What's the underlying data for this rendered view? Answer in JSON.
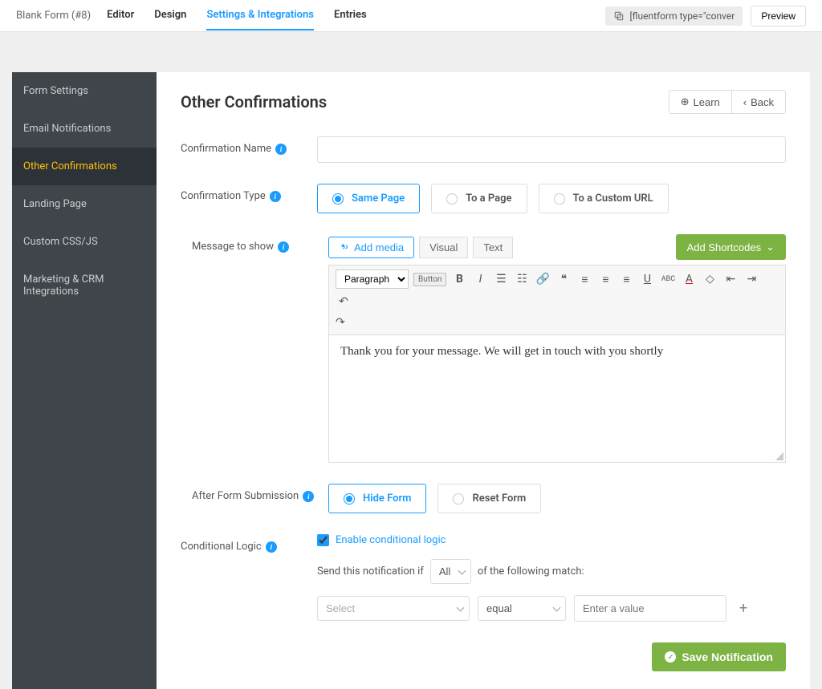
{
  "header": {
    "title": "Blank Form (#8)",
    "tabs": [
      "Editor",
      "Design",
      "Settings & Integrations",
      "Entries"
    ],
    "active_tab_index": 2,
    "shortcode": "[fluentform type=\"conver",
    "preview_label": "Preview"
  },
  "sidebar": {
    "items": [
      "Form Settings",
      "Email Notifications",
      "Other Confirmations",
      "Landing Page",
      "Custom CSS/JS",
      "Marketing & CRM Integrations"
    ],
    "active_index": 2
  },
  "page": {
    "title": "Other Confirmations",
    "learn_label": "Learn",
    "back_label": "Back"
  },
  "fields": {
    "confirmation_name": {
      "label": "Confirmation Name",
      "value": ""
    },
    "confirmation_type": {
      "label": "Confirmation Type",
      "options": [
        "Same Page",
        "To a Page",
        "To a Custom URL"
      ],
      "selected_index": 0
    },
    "message": {
      "label": "Message to show",
      "add_media_label": "Add media",
      "visual_label": "Visual",
      "text_label": "Text",
      "shortcodes_label": "Add Shortcodes",
      "paragraph_label": "Paragraph",
      "button_tag": "Button",
      "body": "Thank you for your message. We will get in touch with you shortly"
    },
    "after_submission": {
      "label": "After Form Submission",
      "options": [
        "Hide Form",
        "Reset Form"
      ],
      "selected_index": 0
    },
    "conditional": {
      "label": "Conditional Logic",
      "enable_label": "Enable conditional logic",
      "enabled": true,
      "prefix_text": "Send this notification if",
      "mode": "All",
      "suffix_text": "of the following match:",
      "rule": {
        "field_placeholder": "Select",
        "operator": "equal",
        "value_placeholder": "Enter a value"
      }
    }
  },
  "save_label": "Save Notification"
}
